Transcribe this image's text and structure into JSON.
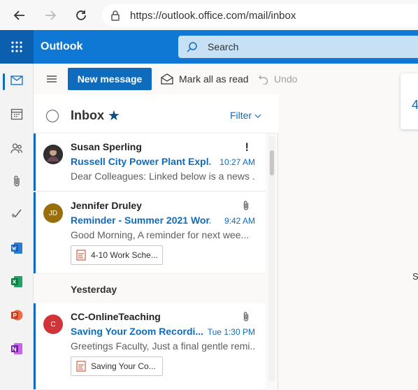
{
  "browser": {
    "url_scheme": "https://",
    "url_host": "outlook.office.com",
    "url_path": "/mail/inbox"
  },
  "suite": {
    "brand": "Outlook",
    "search_placeholder": "Search"
  },
  "rail": [
    "mail-icon",
    "calendar-icon",
    "people-icon",
    "files-icon",
    "todo-icon",
    "word-icon",
    "excel-icon",
    "powerpoint-icon",
    "onenote-icon"
  ],
  "commands": {
    "new_message": "New message",
    "mark_all_read": "Mark all as read",
    "undo": "Undo"
  },
  "list": {
    "folder": "Inbox",
    "filter": "Filter",
    "yesterday": "Yesterday",
    "items": [
      {
        "sender": "Susan Sperling",
        "subject": "Russell City Power Plant Expl...",
        "time": "10:27 AM",
        "preview": "Dear Colleagues: Linked below is a news ...",
        "avatar_initials": "",
        "avatar_color": "#3a3a3a"
      },
      {
        "sender": "Jennifer Druley",
        "subject": "Reminder - Summer 2021 Wor...",
        "time": "9:42 AM",
        "preview": "Good Morning, A reminder for next wee...",
        "avatar_initials": "JD",
        "avatar_color": "#986f0b",
        "attachment": "4-10 Work Sche..."
      },
      {
        "sender": "CC-OnlineTeaching",
        "subject": "Saving Your Zoom Recordi...",
        "time": "Tue 1:30 PM",
        "preview": "Greetings Faculty, Just a final gentle remi...",
        "avatar_initials": "C",
        "avatar_color": "#d13438",
        "attachment": "Saving Your Co..."
      }
    ]
  },
  "reading": {
    "card_glyph": "4",
    "text": "S"
  },
  "colors": {
    "accent": "#0f6cbd",
    "suite_bar": "#0f78d4"
  }
}
